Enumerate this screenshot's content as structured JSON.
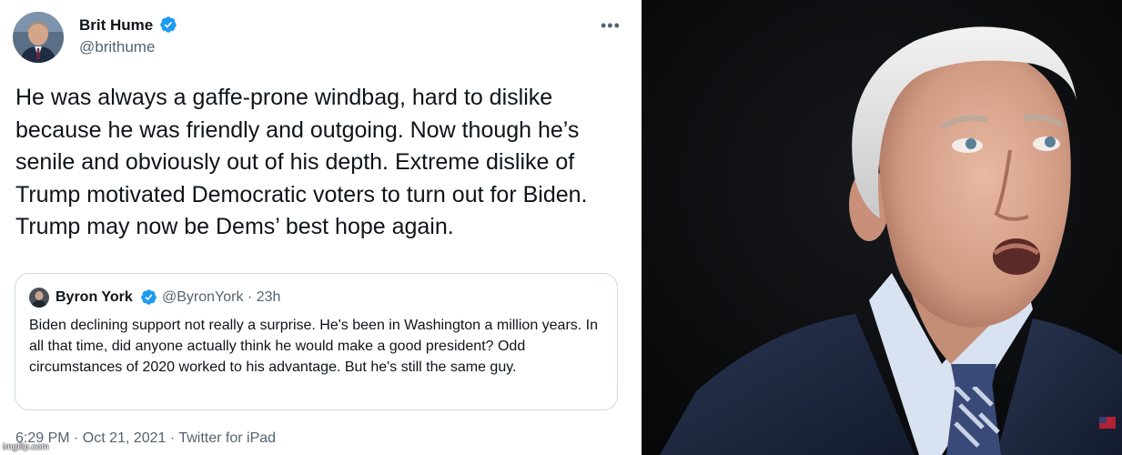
{
  "tweet": {
    "author_name": "Brit Hume",
    "author_handle": "@brithume",
    "more_icon": "more-horizontal-icon",
    "text": "He was always a gaffe-prone windbag, hard to dislike because he was friendly and outgoing. Now though he’s senile and obviously out of his depth. Extreme dislike of Trump motivated Democratic voters to turn out for Biden. Trump may now be Dems’ best hope again.",
    "timestamp": "6:29 PM · Oct 21, 2021 · Twitter for iPad"
  },
  "quoted_tweet": {
    "author_name": "Byron York",
    "author_handle": "@ByronYork · 23h",
    "text": "Biden declining support not really a surprise. He's been in Washington a million years. In all that time, did anyone actually think he would make a good president? Odd circumstances of 2020 worked to his advantage. But he's still the same guy."
  },
  "watermark": "imgflip.com",
  "colors": {
    "verified_badge": "#1d9bf0",
    "secondary_text": "#536471",
    "primary_text": "#0f1419",
    "border": "#cfd9de"
  }
}
